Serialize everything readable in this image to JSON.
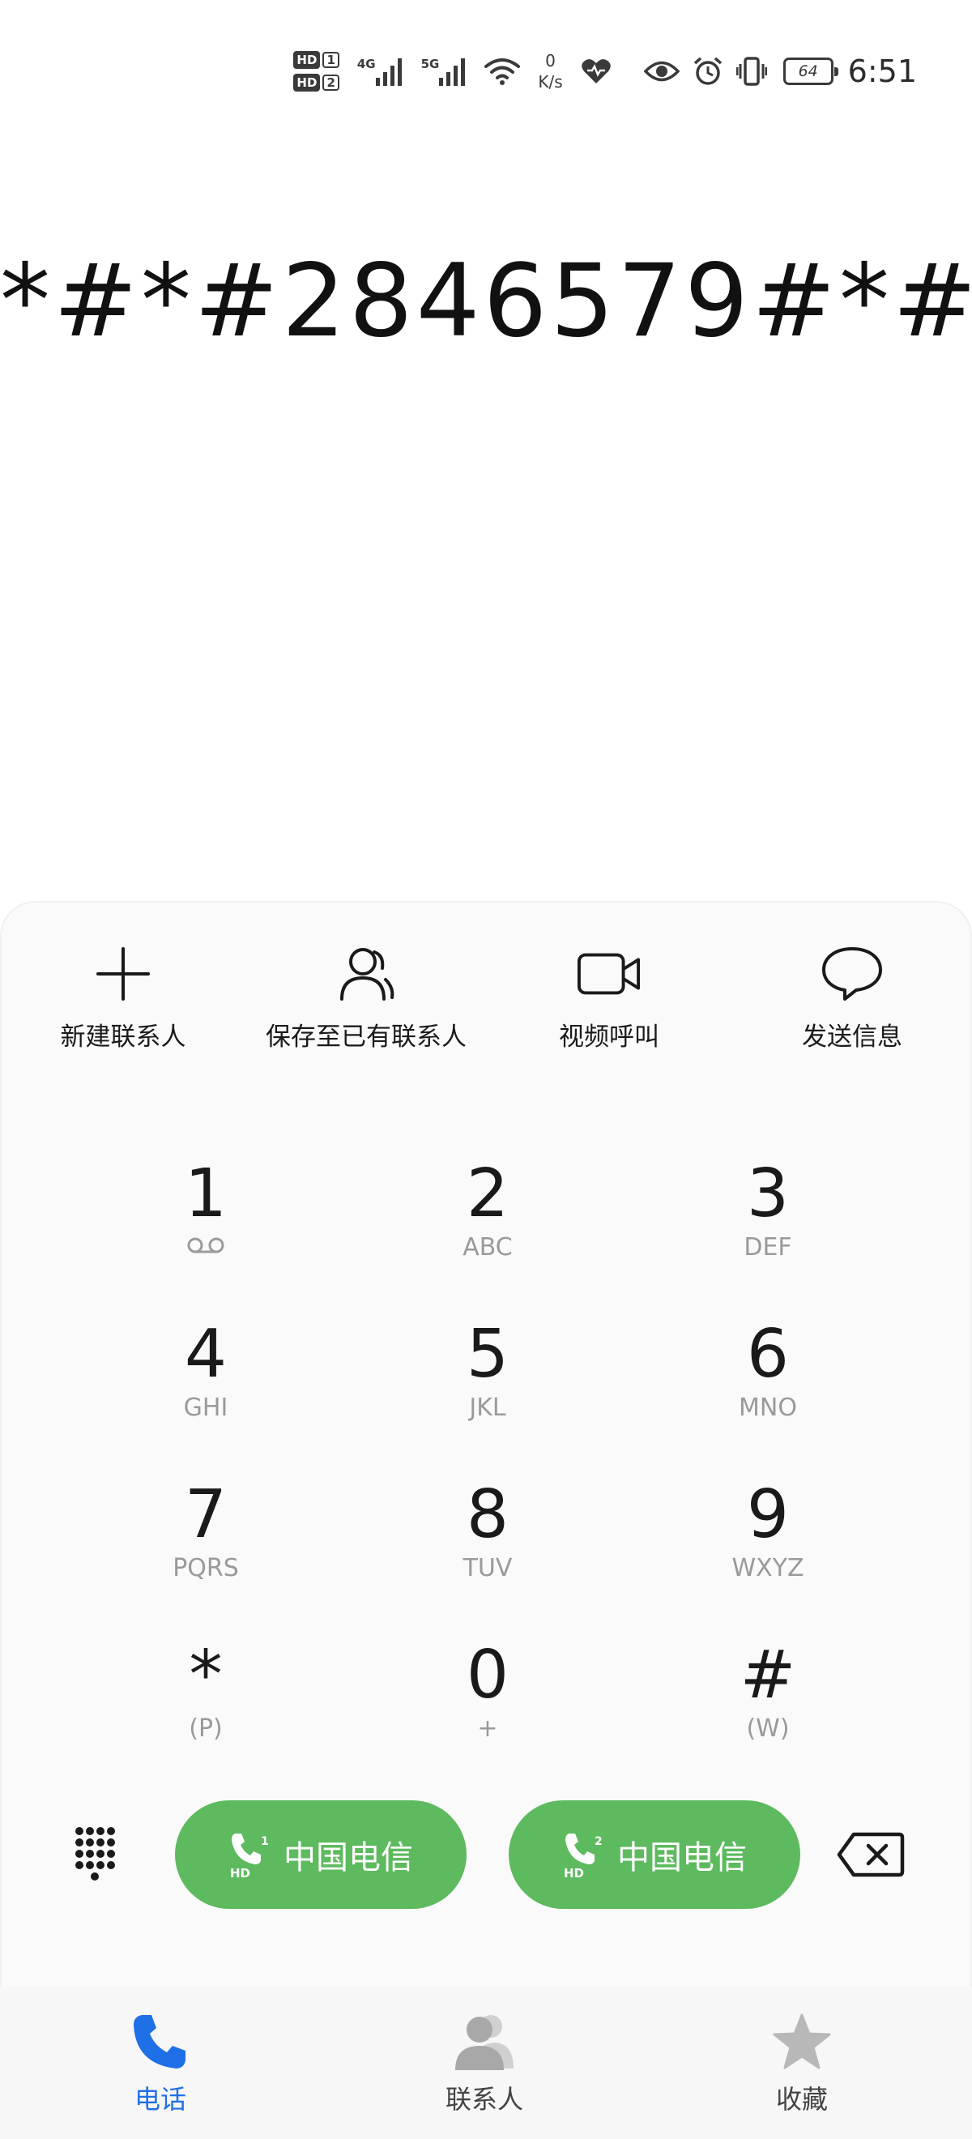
{
  "status_bar": {
    "sim1_label": "HD",
    "sim1_num": "1",
    "sim2_label": "HD",
    "sim2_num": "2",
    "network1": "4G",
    "network2": "5G",
    "speed_value": "0",
    "speed_unit": "K/s",
    "battery": "64",
    "time": "6:51"
  },
  "dialer": {
    "number": "*#*#2846579#*#"
  },
  "actions": [
    {
      "label": "新建联系人",
      "icon": "plus-icon"
    },
    {
      "label": "保存至已有联系人",
      "icon": "person-icon"
    },
    {
      "label": "视频呼叫",
      "icon": "video-camera-icon"
    },
    {
      "label": "发送信息",
      "icon": "message-bubble-icon"
    }
  ],
  "keys": [
    {
      "digit": "1",
      "sub": ""
    },
    {
      "digit": "2",
      "sub": "ABC"
    },
    {
      "digit": "3",
      "sub": "DEF"
    },
    {
      "digit": "4",
      "sub": "GHI"
    },
    {
      "digit": "5",
      "sub": "JKL"
    },
    {
      "digit": "6",
      "sub": "MNO"
    },
    {
      "digit": "7",
      "sub": "PQRS"
    },
    {
      "digit": "8",
      "sub": "TUV"
    },
    {
      "digit": "9",
      "sub": "WXYZ"
    },
    {
      "digit": "*",
      "sub": "(P)"
    },
    {
      "digit": "0",
      "sub": "+"
    },
    {
      "digit": "#",
      "sub": "(W)"
    }
  ],
  "call_buttons": [
    {
      "sim": "1",
      "badge": "HD",
      "label": "中国电信"
    },
    {
      "sim": "2",
      "badge": "HD",
      "label": "中国电信"
    }
  ],
  "bottom_nav": [
    {
      "label": "电话",
      "active": true,
      "icon": "phone-icon"
    },
    {
      "label": "联系人",
      "active": false,
      "icon": "contacts-icon"
    },
    {
      "label": "收藏",
      "active": false,
      "icon": "star-icon"
    }
  ],
  "colors": {
    "call_green": "#5dba5e",
    "active_blue": "#1f6fe6",
    "inactive_gray": "#b8b8b8"
  }
}
